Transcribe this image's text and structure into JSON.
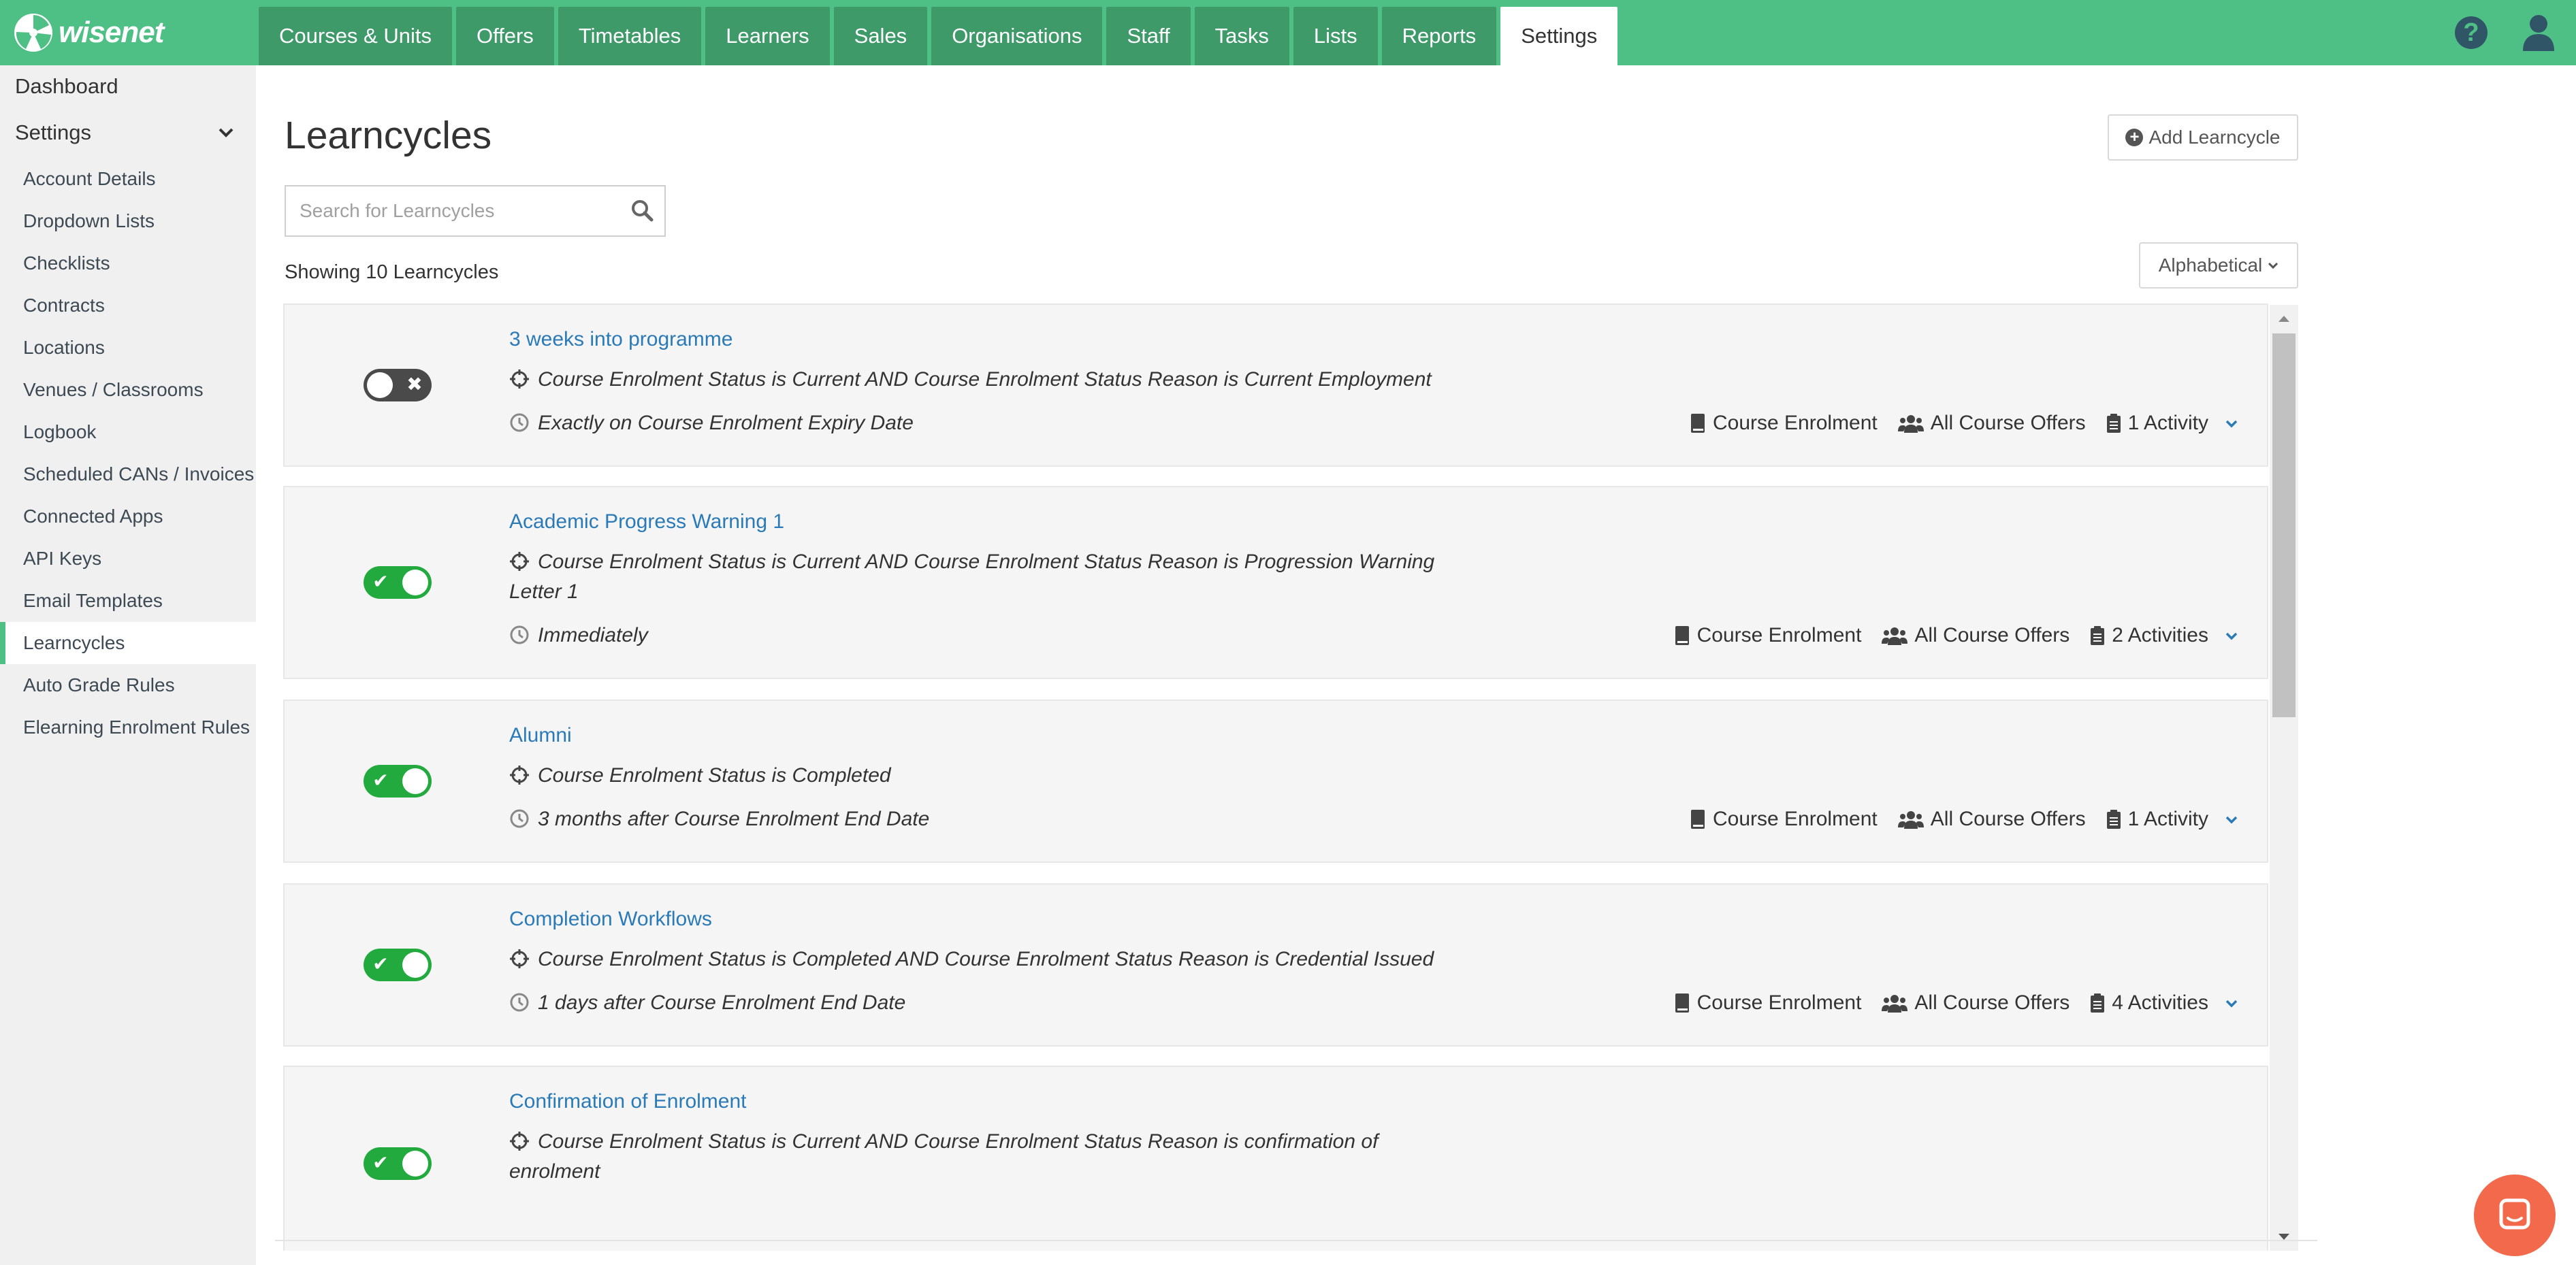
{
  "brand": {
    "name": "wisenet",
    "color": "#4fc085"
  },
  "nav": {
    "tabs": [
      {
        "label": "Courses & Units"
      },
      {
        "label": "Offers"
      },
      {
        "label": "Timetables"
      },
      {
        "label": "Learners"
      },
      {
        "label": "Sales"
      },
      {
        "label": "Organisations"
      },
      {
        "label": "Staff"
      },
      {
        "label": "Tasks"
      },
      {
        "label": "Lists"
      },
      {
        "label": "Reports"
      },
      {
        "label": "Settings",
        "active": true
      }
    ]
  },
  "top_icons": {
    "help": "?",
    "help_icon": "help-icon",
    "user_icon": "user-icon"
  },
  "sidebar": {
    "dashboard": "Dashboard",
    "settings": "Settings",
    "items": [
      {
        "label": "Account Details"
      },
      {
        "label": "Dropdown Lists"
      },
      {
        "label": "Checklists"
      },
      {
        "label": "Contracts"
      },
      {
        "label": "Locations"
      },
      {
        "label": "Venues / Classrooms"
      },
      {
        "label": "Logbook"
      },
      {
        "label": "Scheduled CANs / Invoices"
      },
      {
        "label": "Connected Apps"
      },
      {
        "label": "API Keys"
      },
      {
        "label": "Email Templates"
      },
      {
        "label": "Learncycles",
        "active": true
      },
      {
        "label": "Auto Grade Rules"
      },
      {
        "label": "Elearning Enrolment Rules"
      }
    ]
  },
  "main": {
    "title": "Learncycles",
    "add_button": "Add Learncycle",
    "search_placeholder": "Search for Learncycles",
    "showing": "Showing 10 Learncycles",
    "sort": "Alphabetical",
    "cards": [
      {
        "name": "3 weeks into programme",
        "enabled": false,
        "condition": "Course Enrolment Status is Current AND Course Enrolment Status Reason is Current Employment",
        "schedule": "Exactly on Course Enrolment Expiry Date",
        "entity": "Course Enrolment",
        "offers": "All Course Offers",
        "activities": "1 Activity"
      },
      {
        "name": "Academic Progress Warning 1",
        "enabled": true,
        "condition": "Course Enrolment Status is Current AND Course Enrolment Status Reason is Progression Warning Letter 1",
        "schedule": "Immediately",
        "entity": "Course Enrolment",
        "offers": "All Course Offers",
        "activities": "2 Activities"
      },
      {
        "name": "Alumni",
        "enabled": true,
        "condition": "Course Enrolment Status is Completed",
        "schedule": "3 months after Course Enrolment End Date",
        "entity": "Course Enrolment",
        "offers": "All Course Offers",
        "activities": "1 Activity"
      },
      {
        "name": "Completion Workflows",
        "enabled": true,
        "condition": "Course Enrolment Status is Completed AND Course Enrolment Status Reason is Credential Issued",
        "schedule": "1 days after Course Enrolment End Date",
        "entity": "Course Enrolment",
        "offers": "All Course Offers",
        "activities": "4 Activities"
      },
      {
        "name": "Confirmation of Enrolment",
        "enabled": true,
        "condition": "Course Enrolment Status is Current AND Course Enrolment Status Reason is confirmation of enrolment",
        "schedule": "",
        "entity": "",
        "offers": "",
        "activities": ""
      }
    ]
  },
  "colors": {
    "toggle_on": "#22aa3f",
    "toggle_off": "#4a4a4a",
    "link": "#2a7ab8",
    "chat": "#f26a4b"
  }
}
